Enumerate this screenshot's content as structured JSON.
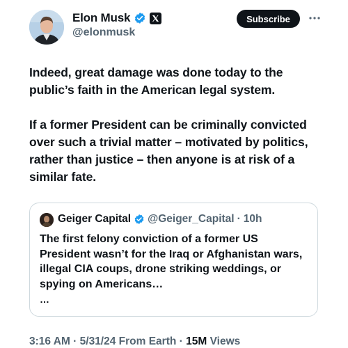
{
  "author": {
    "name": "Elon Musk",
    "handle": "@elonmusk",
    "verified_icon": "verified-badge-icon",
    "affiliate_icon": "x-logo-icon",
    "accent": "#1d9bf0"
  },
  "actions": {
    "subscribe_label": "Subscribe",
    "more_icon": "more-icon"
  },
  "tweet": {
    "paragraph_1": "Indeed, great damage was done today to the public’s faith in the American legal system.",
    "paragraph_2": "If a former President can be criminally convicted over such a trivial matter – motivated by politics, rather than justice – then anyone is at risk of a similar fate."
  },
  "quote": {
    "name": "Geiger Capital",
    "handle": "@Geiger_Capital",
    "separator": "·",
    "time": "10h",
    "text": "The first felony conviction of a former US President wasn’t for the Iraq or Afghanistan wars, illegal CIA coups, drone striking weddings, or spying on Americans…",
    "ellipsis": "…"
  },
  "meta": {
    "time": "3:16 AM",
    "sep1": " · ",
    "date": "5/31/24 From Earth",
    "sep2": " · ",
    "views_count": "15M",
    "views_label": " Views"
  }
}
